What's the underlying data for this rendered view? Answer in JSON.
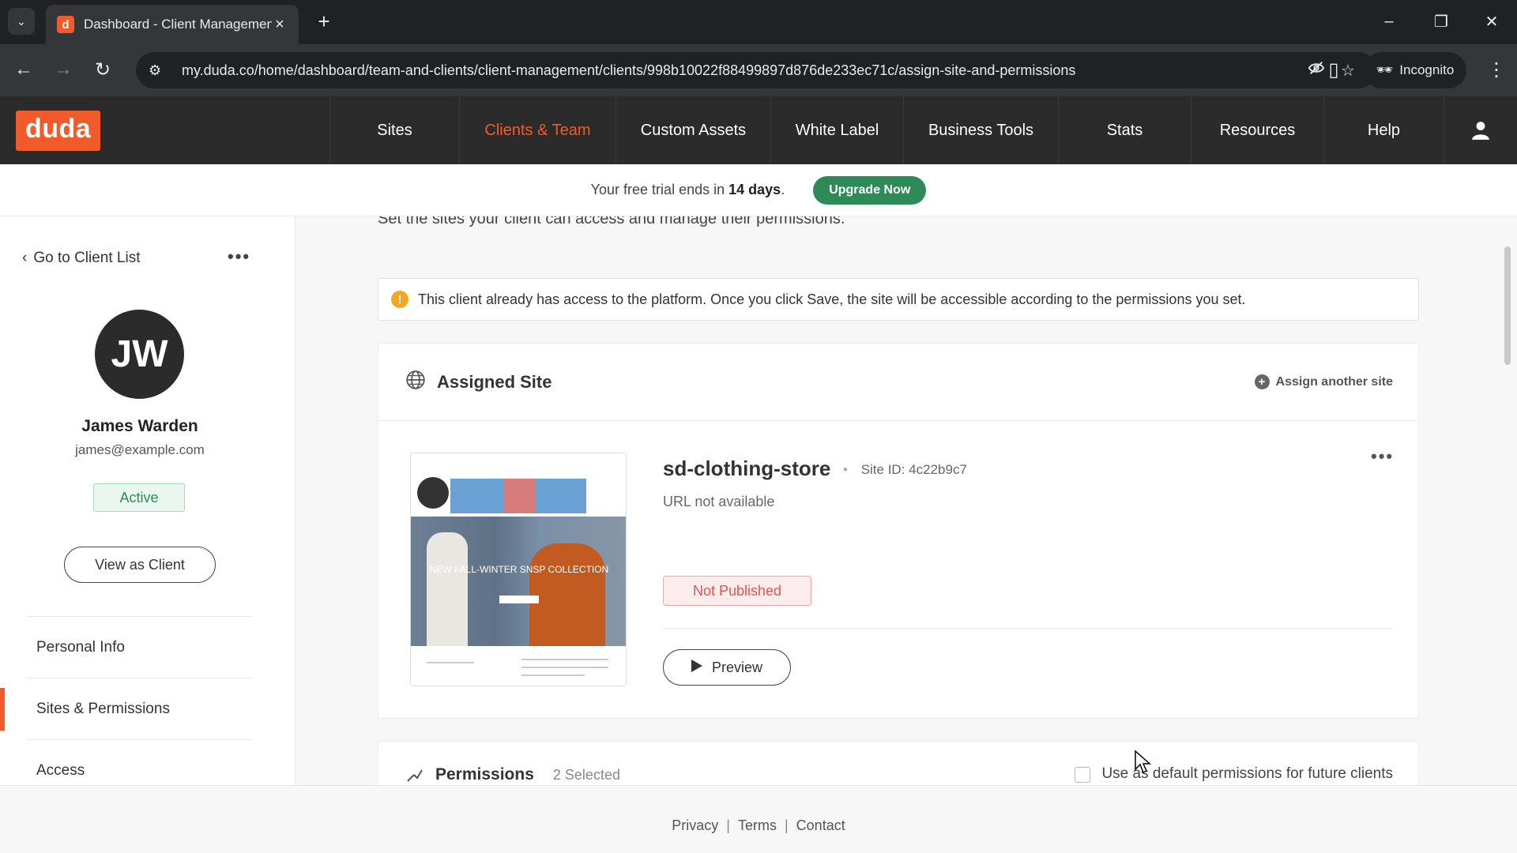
{
  "browser": {
    "tab_title": "Dashboard - Client Management",
    "favicon_letter": "d",
    "url": "my.duda.co/home/dashboard/team-and-clients/client-management/clients/998b10022f88499897d876de233ec71c/assign-site-and-permissions",
    "incognito_label": "Incognito"
  },
  "appnav": {
    "logo": "duda",
    "items": [
      {
        "label": "Sites"
      },
      {
        "label": "Clients & Team"
      },
      {
        "label": "Custom Assets"
      },
      {
        "label": "White Label"
      },
      {
        "label": "Business Tools"
      },
      {
        "label": "Stats"
      },
      {
        "label": "Resources"
      },
      {
        "label": "Help"
      }
    ]
  },
  "trial": {
    "prefix": "Your free trial ends in",
    "days": "14 days",
    "suffix": ".",
    "upgrade_label": "Upgrade Now"
  },
  "sidebar": {
    "back_label": "Go to Client List",
    "initials": "JW",
    "name": "James Warden",
    "email": "james@example.com",
    "status": "Active",
    "view_as_client": "View as Client",
    "menu": [
      {
        "label": "Personal Info"
      },
      {
        "label": "Sites & Permissions"
      },
      {
        "label": "Access"
      }
    ]
  },
  "main": {
    "subtitle": "Set the sites your client can access and manage their permissions.",
    "notice": "This client already has access to the platform. Once you click Save, the site will be accessible according to the permissions you set.",
    "assigned_site": {
      "title": "Assigned Site",
      "assign_another": "Assign another site",
      "site_name": "sd-clothing-store",
      "site_id_label": "Site ID:",
      "site_id": "4c22b9c7",
      "url_status": "URL not available",
      "publish_status": "Not Published",
      "preview_label": "Preview",
      "thumbnail_text": "NEW FALL-WINTER SNSP COLLECTION"
    },
    "permissions": {
      "title": "Permissions",
      "selected": "2 Selected",
      "default_label": "Use as default permissions for future clients"
    }
  },
  "footer": {
    "links": [
      {
        "label": "Privacy"
      },
      {
        "label": "Terms"
      },
      {
        "label": "Contact"
      }
    ],
    "separator": "|"
  },
  "colors": {
    "brand": "#f15a2b",
    "success": "#2e8a57",
    "danger": "#e25555"
  }
}
